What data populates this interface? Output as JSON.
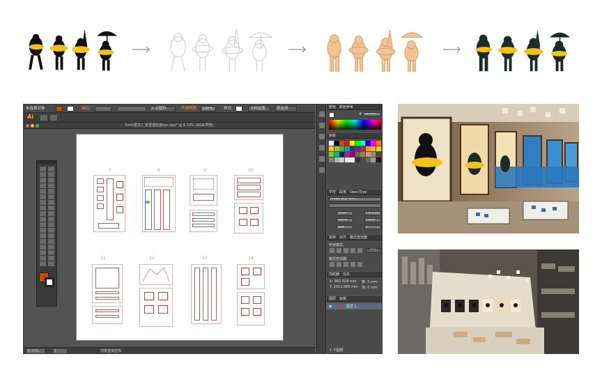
{
  "workflow": {
    "stages": [
      {
        "name": "filled-black",
        "fill": "#111111",
        "float": "#f2c21b"
      },
      {
        "name": "outline",
        "fill": "#ffffff",
        "float": "#ffffff"
      },
      {
        "name": "wood",
        "fill": "#f3c391",
        "float": "#f3c391"
      },
      {
        "name": "painted",
        "fill": "#1d2b2a",
        "float": "#f2c21b"
      }
    ]
  },
  "illustrator": {
    "control_bar": {
      "selection": "未选择对象",
      "stroke_label": "描边:",
      "stroke_profile": "3 点圆形",
      "opacity_label": "不透明度:",
      "opacity_value": "100%",
      "style_label": "样式:",
      "doc_setup": "文档设置",
      "prefs": "首选项"
    },
    "app_logo": "Ai",
    "document_title": "5mm框件2_变更透快速eps.eps* @ 8.33% (RGB/预览)",
    "artboard_numbers": [
      "7",
      "8",
      "9",
      "10",
      "11",
      "12",
      "13",
      "14"
    ],
    "status": {
      "zoom": "8.33%",
      "page": "1",
      "tool_hint": "切换直接选择"
    },
    "color_panel": {
      "tabs": [
        "颜色",
        "颜色参考"
      ],
      "hex": "d24900"
    },
    "swatches_panel": {
      "title": "色板"
    },
    "character_panel": {
      "tabs": [
        "字符",
        "段落",
        "OpenType"
      ],
      "font_family": "Adobe 宋体 Std L",
      "font_size": "12 pt",
      "leading": "(14.4 pt)",
      "vscale": "100%",
      "hscale": "100%",
      "tracking_auto": "自动",
      "tracking": "0"
    },
    "pathfinder_panel": {
      "tabs": [
        "变换",
        "对齐",
        "路径查找器"
      ],
      "shape_modes_label": "形状模式:",
      "expand_label": "扩展",
      "pathfinder_label": "路径查找器:"
    },
    "info_panel": {
      "tabs": [
        "导航器",
        "信息"
      ],
      "x": "X: 982.024 mm",
      "y": "Y: 1011.669 mm",
      "w": "宽: 0 mm",
      "h": "高: 0 mm"
    },
    "layers_panel": {
      "tabs": [
        "图层",
        "画板"
      ],
      "layer_name": "图层 1",
      "footer": "1 个图层"
    }
  },
  "colors": {
    "ai_orange": "#d24900",
    "ai_logo": "#f7a33b",
    "artboard_red": "#c04040"
  }
}
